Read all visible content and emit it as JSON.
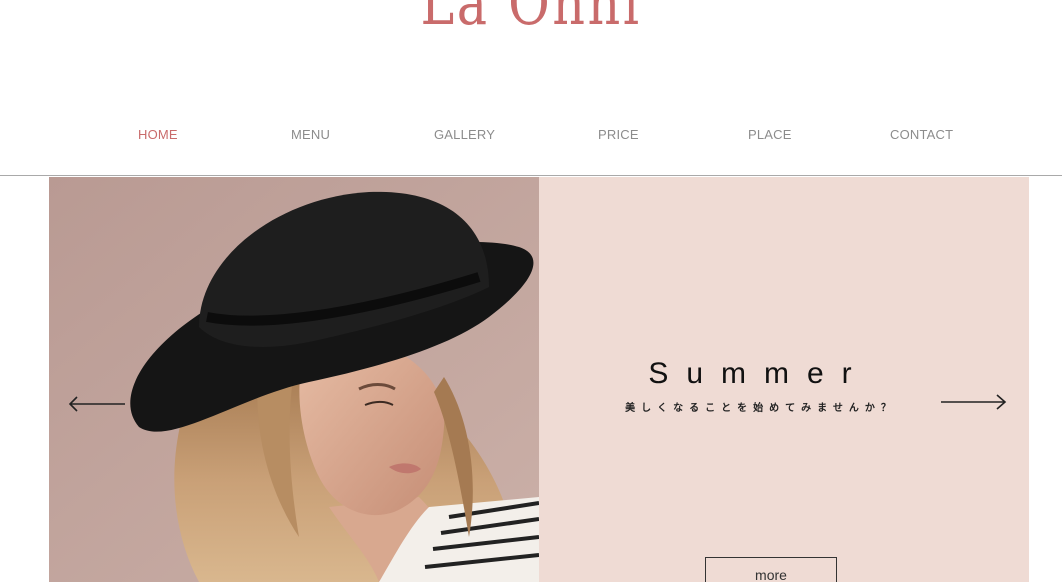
{
  "site": {
    "logo": "La Onni",
    "brand_color": "#c96b6b"
  },
  "nav": {
    "items": [
      {
        "label": "HOME",
        "active": true
      },
      {
        "label": "MENU",
        "active": false
      },
      {
        "label": "GALLERY",
        "active": false
      },
      {
        "label": "PRICE",
        "active": false
      },
      {
        "label": "PLACE",
        "active": false
      },
      {
        "label": "CONTACT",
        "active": false
      }
    ]
  },
  "slide": {
    "title": "Summer",
    "subtitle": "美しくなることを始めてみませんか？",
    "button_label": "more",
    "background_color": "#efdbd4",
    "image_icon": "woman-in-black-hat-photo",
    "prev_icon": "arrow-left-icon",
    "next_icon": "arrow-right-icon"
  }
}
